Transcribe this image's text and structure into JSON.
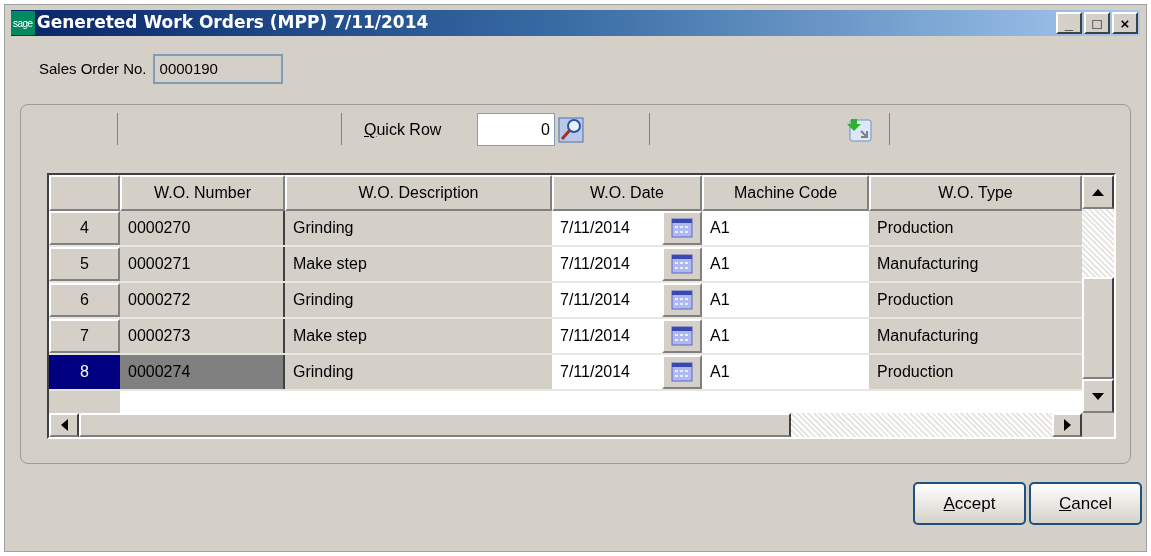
{
  "window": {
    "logo": "sage",
    "title": "Genereted Work Orders (MPP) 7/11/2014",
    "controls": [
      "_",
      "□",
      "×"
    ]
  },
  "sales_order": {
    "label": "Sales Order No.",
    "value": "0000190"
  },
  "toolbar": {
    "quick_row_label": "Quick Row",
    "quick_row_value": "0"
  },
  "table": {
    "columns": [
      "W.O. Number",
      "W.O. Description",
      "W.O. Date",
      "Machine Code",
      "W.O. Type"
    ],
    "rows": [
      {
        "row": "4",
        "number": "0000270",
        "description": "Grinding",
        "date": "7/11/2014",
        "machine": "A1",
        "type": "Production",
        "selected": false
      },
      {
        "row": "5",
        "number": "0000271",
        "description": "Make step",
        "date": "7/11/2014",
        "machine": "A1",
        "type": "Manufacturing",
        "selected": false
      },
      {
        "row": "6",
        "number": "0000272",
        "description": "Grinding",
        "date": "7/11/2014",
        "machine": "A1",
        "type": "Production",
        "selected": false
      },
      {
        "row": "7",
        "number": "0000273",
        "description": "Make step",
        "date": "7/11/2014",
        "machine": "A1",
        "type": "Manufacturing",
        "selected": false
      },
      {
        "row": "8",
        "number": "0000274",
        "description": "Grinding",
        "date": "7/11/2014",
        "machine": "A1",
        "type": "Production",
        "selected": true
      }
    ]
  },
  "buttons": [
    "Accept",
    "Cancel"
  ]
}
